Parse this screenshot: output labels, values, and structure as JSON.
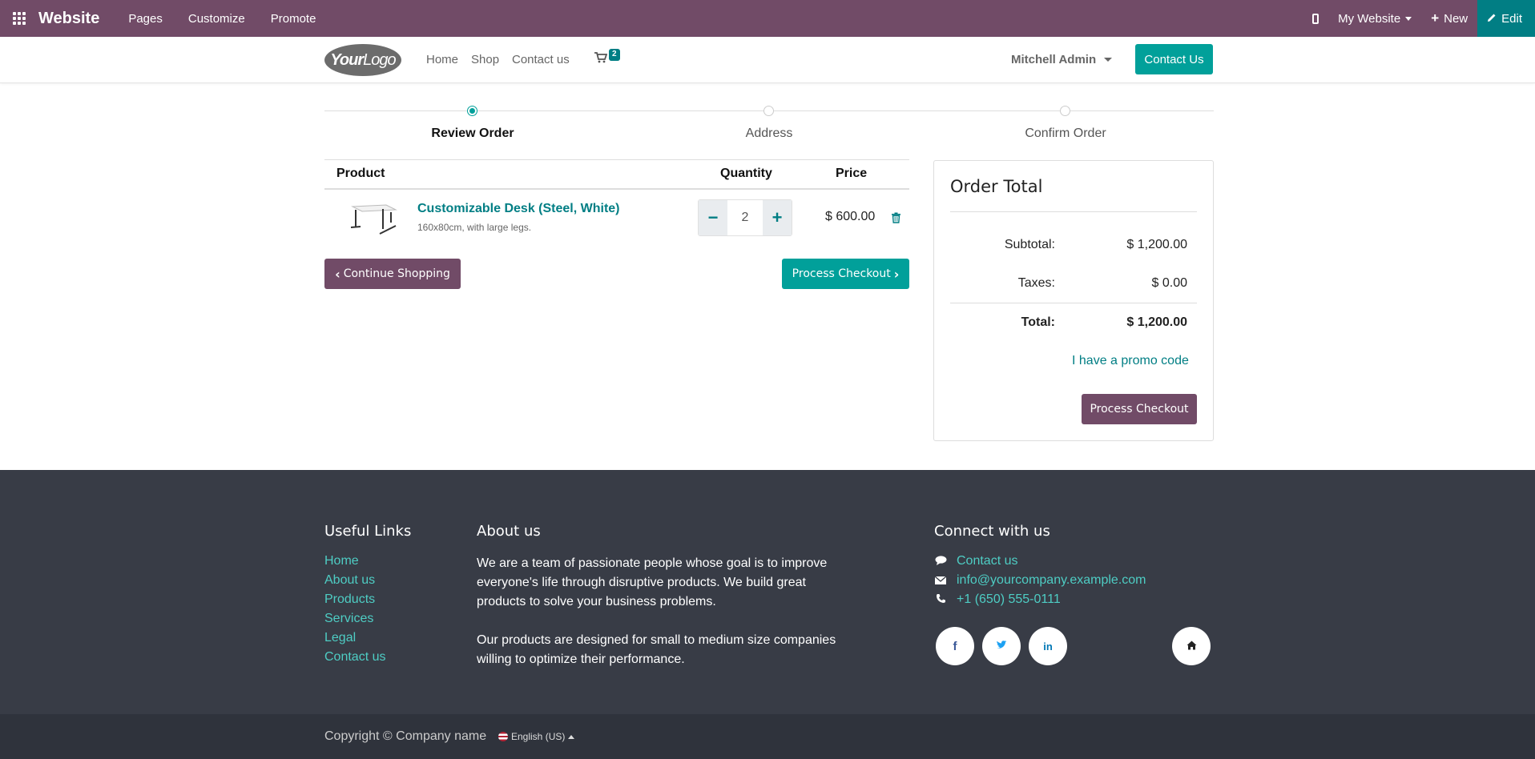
{
  "adminbar": {
    "brand": "Website",
    "menu": [
      "Pages",
      "Customize",
      "Promote"
    ],
    "site_selector": "My Website",
    "new_label": "New",
    "edit_label": "Edit"
  },
  "header": {
    "logo_text_bold": "Your",
    "logo_text": "Logo",
    "nav": [
      "Home",
      "Shop",
      "Contact us"
    ],
    "cart_count": "2",
    "user": "Mitchell Admin",
    "contact_button": "Contact Us"
  },
  "progress": {
    "steps": [
      "Review Order",
      "Address",
      "Confirm Order"
    ],
    "active_index": 0
  },
  "cart": {
    "columns": [
      "Product",
      "Quantity",
      "Price"
    ],
    "items": [
      {
        "name": "Customizable Desk (Steel, White)",
        "description": "160x80cm, with large legs.",
        "quantity": "2",
        "price": "$ 600.00"
      }
    ],
    "continue_label": "Continue Shopping",
    "checkout_label": "Process Checkout"
  },
  "order_total": {
    "title": "Order Total",
    "subtotal_label": "Subtotal:",
    "subtotal": "$ 1,200.00",
    "taxes_label": "Taxes:",
    "taxes": "$ 0.00",
    "total_label": "Total:",
    "total": "$ 1,200.00",
    "promo_label": "I have a promo code",
    "checkout_label": "Process Checkout"
  },
  "footer": {
    "useful_links_title": "Useful Links",
    "useful_links": [
      "Home",
      "About us",
      "Products",
      "Services",
      "Legal",
      "Contact us"
    ],
    "about_title": "About us",
    "about_p1": "We are a team of passionate people whose goal is to improve everyone's life through disruptive products. We build great products to solve your business problems.",
    "about_p2": "Our products are designed for small to medium size companies willing to optimize their performance.",
    "connect_title": "Connect with us",
    "contact_link": "Contact us",
    "email": "info@yourcompany.example.com",
    "phone": "+1 (650) 555-0111",
    "copyright": "Copyright © Company name",
    "language": "English (US)"
  },
  "colors": {
    "odoo_purple": "#714B67",
    "teal": "#01A09A",
    "dark_teal": "#017E84",
    "footer_bg": "#383C46"
  }
}
